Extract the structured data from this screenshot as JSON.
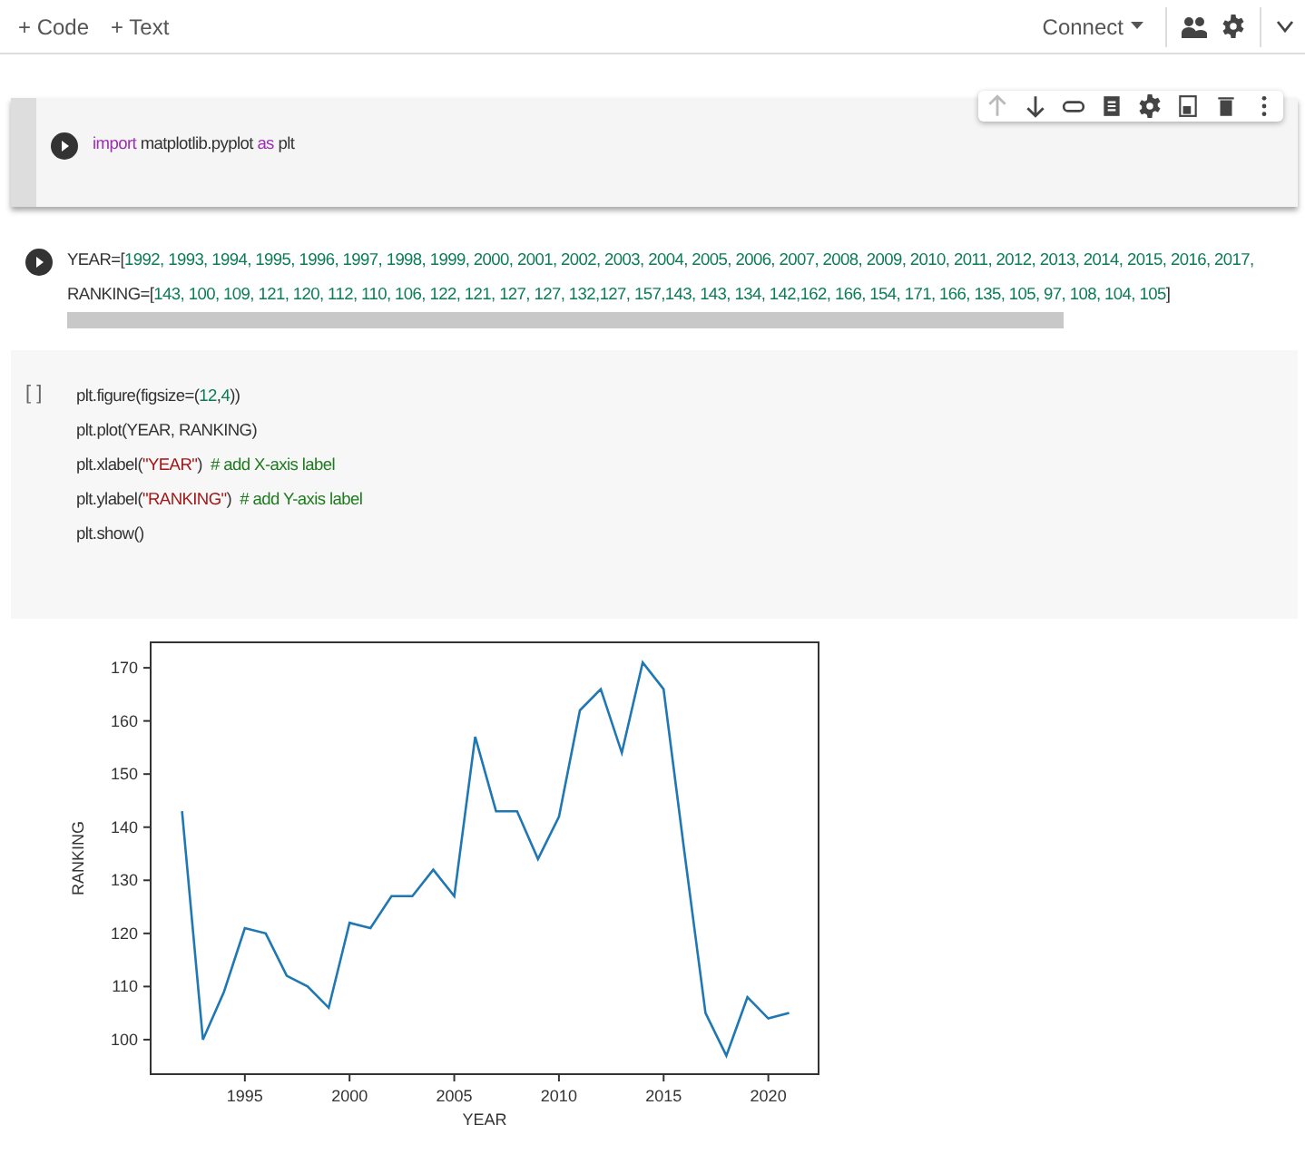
{
  "toolbar": {
    "add_buttons": [
      "+ Code",
      "+ Text"
    ],
    "connect": "Connect"
  },
  "cells": [
    {
      "kind": "executed",
      "focused": true,
      "scrollbar": false,
      "lines": [
        [
          {
            "t": "import",
            "kind": "keyword"
          },
          {
            "t": " matplotlib.pyplot ",
            "kind": "plain"
          },
          {
            "t": "as",
            "kind": "keyword"
          },
          {
            "t": " plt",
            "kind": "plain"
          }
        ]
      ]
    },
    {
      "kind": "executed",
      "focused": false,
      "scrollbar": true,
      "lines": [
        [
          {
            "t": "YEAR=[",
            "kind": "plain"
          },
          {
            "t": "1992, 1993, 1994, 1995, 1996, 1997, 1998, 1999, 2000, 2001, 2002, 2003, 2004, 2005, 2006, 2007, 2008, 2009, 2010, 2011, 2012, 2013, 2014, 2015, 2016, 2017,",
            "kind": "number"
          }
        ],
        [
          {
            "t": "RANKING=[",
            "kind": "plain"
          },
          {
            "t": "143, 100, 109, 121, 120, 112, 110, 106, 122, 121, 127, 127, 132,127, 157,143, 143, 134, 142,162, 166, 154, 171, 166, 135, 105, 97, 108, 104, 105",
            "kind": "number"
          },
          {
            "t": "]",
            "kind": "plain"
          }
        ]
      ]
    },
    {
      "kind": "idle",
      "prompt": "[ ]",
      "focused": false,
      "scrollbar": false,
      "lines": [
        [
          {
            "t": "plt.figure(figsize=(",
            "kind": "plain"
          },
          {
            "t": "12",
            "kind": "number"
          },
          {
            "t": ",",
            "kind": "plain"
          },
          {
            "t": "4",
            "kind": "number"
          },
          {
            "t": "))",
            "kind": "plain"
          }
        ],
        [
          {
            "t": "plt.plot(YEAR, RANKING)",
            "kind": "plain"
          }
        ],
        [
          {
            "t": "plt.xlabel(",
            "kind": "plain"
          },
          {
            "t": "\"YEAR\"",
            "kind": "string"
          },
          {
            "t": ")  ",
            "kind": "plain"
          },
          {
            "t": "# add X-axis label",
            "kind": "comment"
          }
        ],
        [
          {
            "t": "plt.ylabel(",
            "kind": "plain"
          },
          {
            "t": "\"RANKING\"",
            "kind": "string"
          },
          {
            "t": ")  ",
            "kind": "plain"
          },
          {
            "t": "# add Y-axis label",
            "kind": "comment"
          }
        ],
        [
          {
            "t": "plt.show()",
            "kind": "plain"
          }
        ]
      ]
    }
  ],
  "output": {
    "chart_data": {
      "type": "line",
      "xlabel": "YEAR",
      "ylabel": "RANKING",
      "x": [
        1992,
        1993,
        1994,
        1995,
        1996,
        1997,
        1998,
        1999,
        2000,
        2001,
        2002,
        2003,
        2004,
        2005,
        2006,
        2007,
        2008,
        2009,
        2010,
        2011,
        2012,
        2013,
        2014,
        2015,
        2016,
        2017,
        2018,
        2019,
        2020,
        2021
      ],
      "series": [
        {
          "color": "#1f77b4",
          "values": [
            143,
            100,
            109,
            121,
            120,
            112,
            110,
            106,
            122,
            121,
            127,
            127,
            132,
            127,
            157,
            143,
            143,
            134,
            142,
            162,
            166,
            154,
            171,
            166,
            135,
            105,
            97,
            108,
            104,
            105
          ]
        }
      ],
      "xlim": [
        1990.5,
        2022.4
      ],
      "ylim": [
        93.5,
        174.8
      ],
      "xticks": [
        1995,
        2000,
        2005,
        2010,
        2015,
        2020
      ],
      "yticks": [
        100,
        110,
        120,
        130,
        140,
        150,
        160,
        170
      ]
    }
  }
}
